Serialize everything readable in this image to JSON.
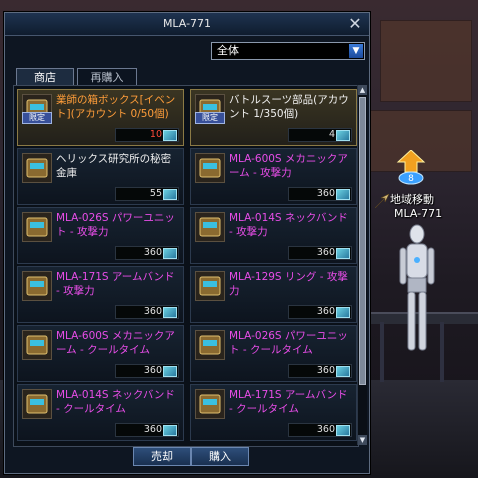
{
  "window": {
    "title": "MLA-771"
  },
  "filter": {
    "selected": "全体"
  },
  "tabs": {
    "shop": "商店",
    "rebuy": "再購入"
  },
  "npc": {
    "line1": "地域移動",
    "line2": "MLA-771"
  },
  "items": [
    {
      "name": "業師の箱ボックス[イベント](アカウント 0/50個)",
      "color": "orange",
      "price": "10",
      "price_color": "red",
      "limited": "限定",
      "icon": "treasure-box-icon",
      "selected": true
    },
    {
      "name": "バトルスーツ部品(アカウント 1/350個)",
      "color": "white",
      "price": "4",
      "price_color": "white",
      "limited": "限定",
      "icon": "suit-parts-icon",
      "selected": true
    },
    {
      "name": "ヘリックス研究所の秘密金庫",
      "color": "white",
      "price": "55",
      "price_color": "white",
      "limited": "",
      "icon": "safe-box-icon",
      "selected": false
    },
    {
      "name": "MLA-600S メカニックアーム - 攻撃力",
      "color": "magenta",
      "price": "360",
      "price_color": "white",
      "limited": "",
      "icon": "mechanic-arm-icon",
      "selected": false
    },
    {
      "name": "MLA-026S パワーユニット - 攻撃力",
      "color": "magenta",
      "price": "360",
      "price_color": "white",
      "limited": "",
      "icon": "power-unit-icon",
      "selected": false
    },
    {
      "name": "MLA-014S ネックバンド - 攻撃力",
      "color": "magenta",
      "price": "360",
      "price_color": "white",
      "limited": "",
      "icon": "neckband-icon",
      "selected": false
    },
    {
      "name": "MLA-171S アームバンド - 攻撃力",
      "color": "magenta",
      "price": "360",
      "price_color": "white",
      "limited": "",
      "icon": "armband-icon",
      "selected": false
    },
    {
      "name": "MLA-129S リング - 攻撃力",
      "color": "magenta",
      "price": "360",
      "price_color": "white",
      "limited": "",
      "icon": "ring-icon",
      "selected": false
    },
    {
      "name": "MLA-600S メカニックアーム - クールタイム",
      "color": "magenta",
      "price": "360",
      "price_color": "white",
      "limited": "",
      "icon": "mechanic-arm-icon",
      "selected": false
    },
    {
      "name": "MLA-026S パワーユニット - クールタイム",
      "color": "magenta",
      "price": "360",
      "price_color": "white",
      "limited": "",
      "icon": "power-unit-icon",
      "selected": false
    },
    {
      "name": "MLA-014S ネックバンド - クールタイム",
      "color": "magenta",
      "price": "360",
      "price_color": "white",
      "limited": "",
      "icon": "neckband-icon",
      "selected": false
    },
    {
      "name": "MLA-171S アームバンド - クールタイム",
      "color": "magenta",
      "price": "360",
      "price_color": "white",
      "limited": "",
      "icon": "armband-icon",
      "selected": false
    }
  ],
  "buttons": {
    "sell": "売却",
    "buy": "購入"
  },
  "colors": {
    "accent": "#3b7bd8",
    "magenta": "#e84de8",
    "orange": "#ff9d3a",
    "price_red": "#ff4a3a"
  }
}
